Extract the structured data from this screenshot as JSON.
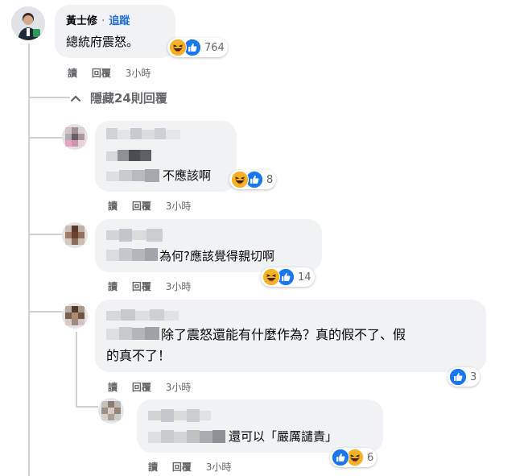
{
  "main_comment": {
    "author": "黃士修",
    "separator": "·",
    "follow_label": "追蹤",
    "text": "總統府震怒。",
    "reaction_count": "764",
    "actions": {
      "read": "讀",
      "reply": "回覆",
      "time": "3小時"
    }
  },
  "hide_replies_label": "隱藏24則回覆",
  "replies": [
    {
      "text": "不應該啊",
      "reaction_count": "8",
      "actions": {
        "read": "讀",
        "reply": "回覆",
        "time": "3小時"
      }
    },
    {
      "text": "為何?應該覺得親切啊",
      "reaction_count": "14",
      "actions": {
        "read": "讀",
        "reply": "回覆",
        "time": "3小時"
      }
    },
    {
      "text_line1": "除了震怒還能有什麼作為？真的假不了、假",
      "text_line2": "的真不了！",
      "reaction_count": "3",
      "actions": {
        "read": "讀",
        "reply": "回覆",
        "time": "3小時"
      }
    },
    {
      "text": "還可以「嚴厲譴責」",
      "reaction_count": "6",
      "actions": {
        "read": "讀",
        "reply": "回覆",
        "time": "3小時"
      }
    }
  ],
  "icons": {
    "haha": "haha-reaction-icon",
    "like": "like-reaction-icon",
    "chevron": "chevron-up-icon"
  },
  "colors": {
    "bubble": "#f0f2f5",
    "link": "#216fdb",
    "meta": "#65676b",
    "like": "#1877f2",
    "haha": "#f7b125"
  }
}
